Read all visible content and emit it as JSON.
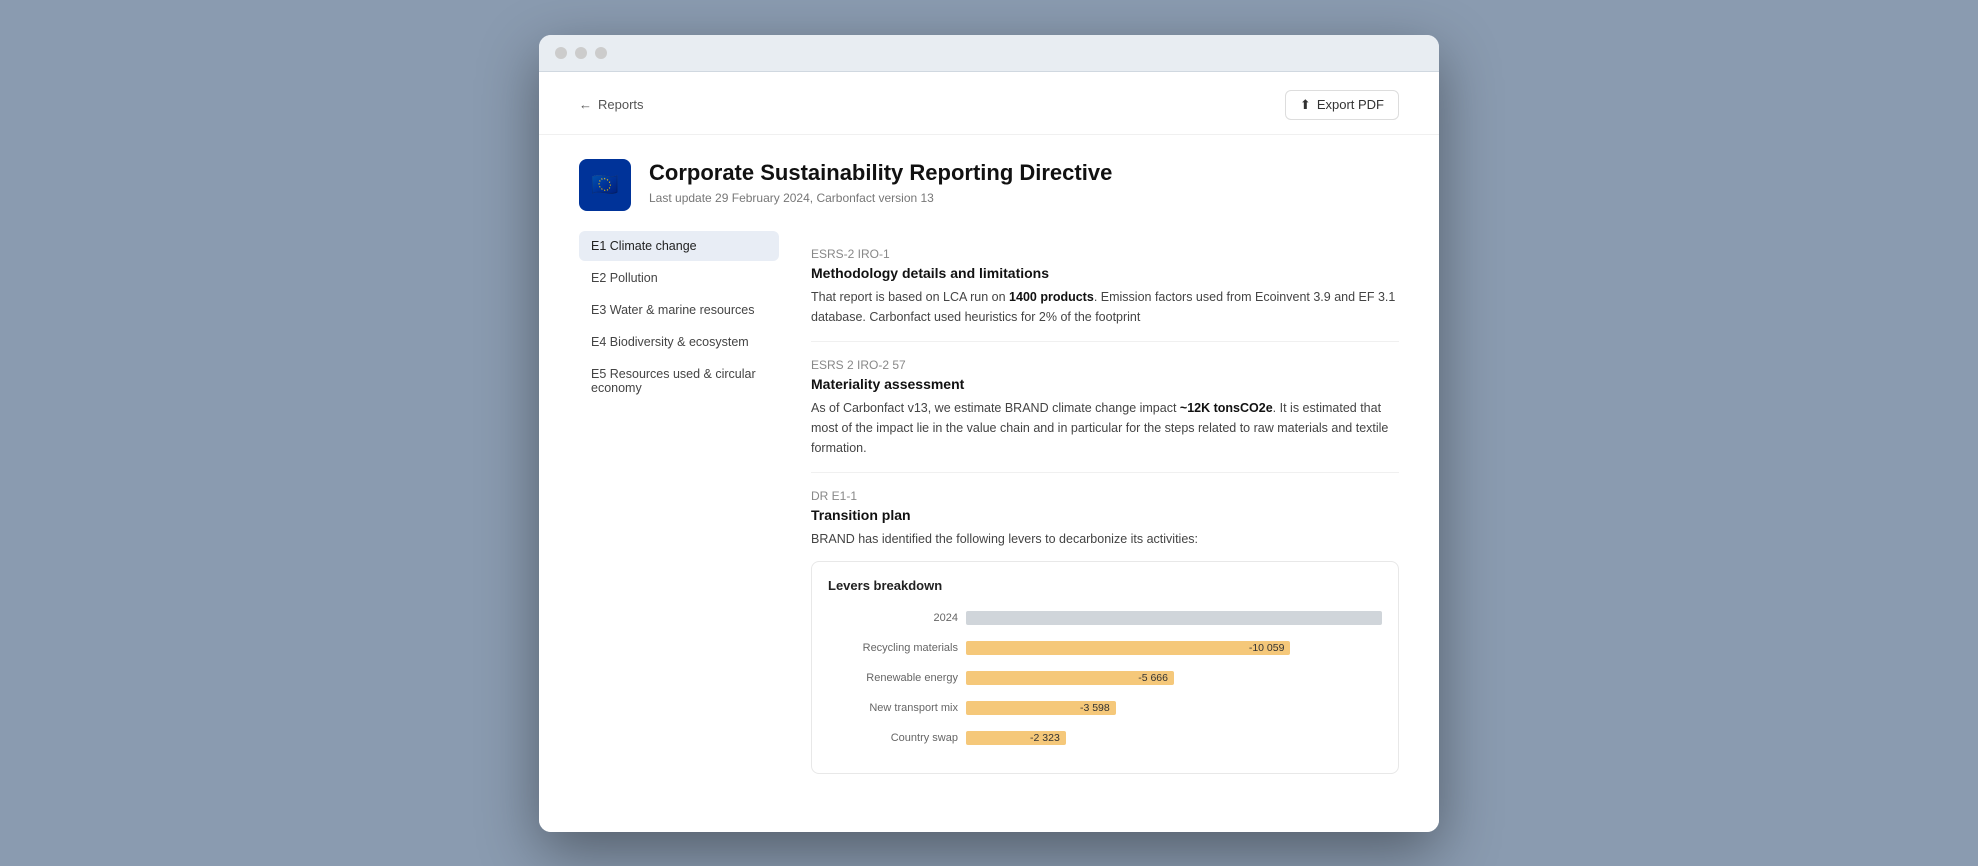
{
  "browser": {
    "dots": [
      "dot1",
      "dot2",
      "dot3"
    ]
  },
  "nav": {
    "back_label": "Reports",
    "export_label": "Export PDF"
  },
  "header": {
    "title": "Corporate Sustainability Reporting Directive",
    "subtitle": "Last update 29 February 2024, Carbonfact version 13"
  },
  "sidebar": {
    "items": [
      {
        "id": "e1",
        "label": "E1 Climate change",
        "active": true
      },
      {
        "id": "e2",
        "label": "E2 Pollution",
        "active": false
      },
      {
        "id": "e3",
        "label": "E3 Water & marine resources",
        "active": false
      },
      {
        "id": "e4",
        "label": "E4 Biodiversity & ecosystem",
        "active": false
      },
      {
        "id": "e5",
        "label": "E5 Resources used & circular economy",
        "active": false
      }
    ]
  },
  "content": {
    "section1": {
      "label": "ESRS-2 IRO-1",
      "title": "Methodology details and limitations",
      "text1": "That report is based on LCA run on ",
      "bold1": "1400 products",
      "text2": ". Emission factors used from Ecoinvent 3.9 and EF 3.1 database. Carbonfact used heuristics for 2% of the footprint"
    },
    "section2": {
      "label": "ESRS 2 IRO-2 57",
      "title": "Materiality assessment",
      "text1": "As of Carbonfact v13, we estimate BRAND climate change impact ",
      "bold1": "~12K tonsCO2e",
      "text2": ". It is estimated that most of the impact lie in the value chain and in particular for the steps related to raw materials and textile formation."
    },
    "section3": {
      "label": "DR E1-1",
      "title": "Transition plan",
      "text1": "BRAND has identified the following levers to decarbonize its activities:"
    },
    "chart": {
      "title": "Levers breakdown",
      "rows": [
        {
          "label": "2024",
          "type": "baseline",
          "value": null,
          "display": null
        },
        {
          "label": "Recycling materials",
          "type": "bar",
          "width_pct": 78,
          "value": "-10 059"
        },
        {
          "label": "Renewable energy",
          "type": "bar",
          "width_pct": 50,
          "value": "-5 666"
        },
        {
          "label": "New transport mix",
          "type": "bar",
          "width_pct": 36,
          "value": "-3 598"
        },
        {
          "label": "Country swap",
          "type": "bar",
          "width_pct": 24,
          "value": "-2 323"
        }
      ]
    }
  }
}
